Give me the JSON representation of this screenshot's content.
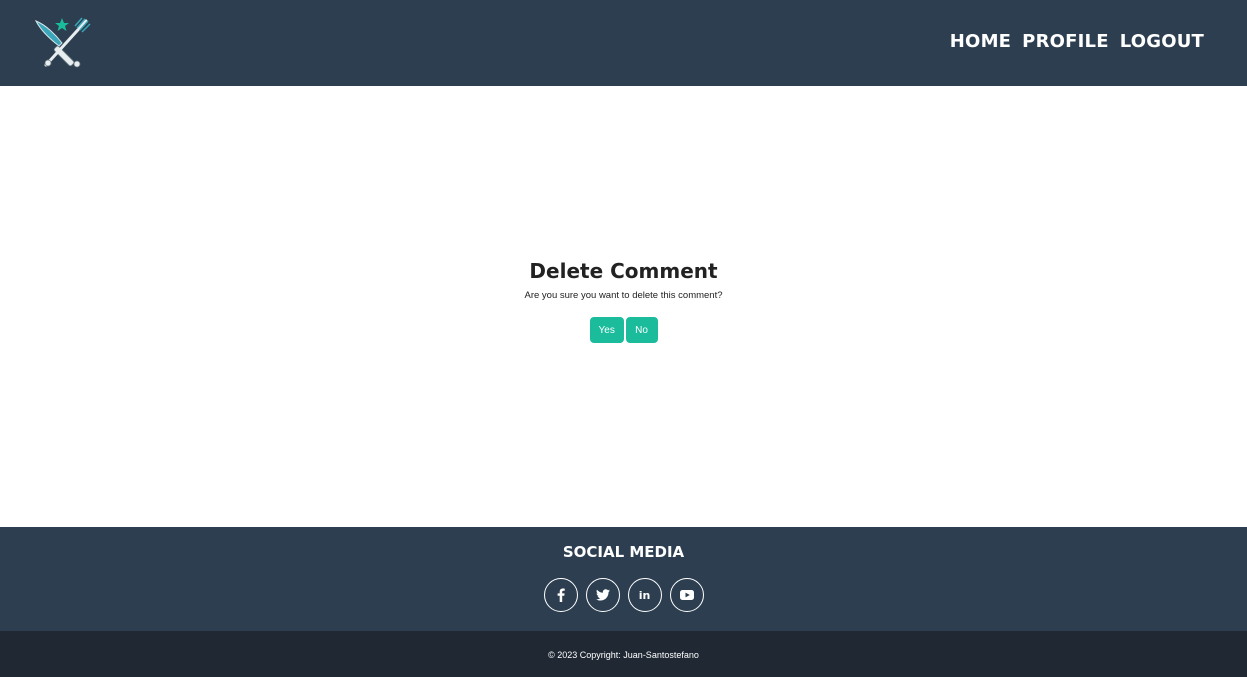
{
  "navbar": {
    "logo_icon": "crossed-knife-fork-logo-icon",
    "links": [
      {
        "label": "HOME"
      },
      {
        "label": "PROFILE"
      },
      {
        "label": "LOGOUT"
      }
    ]
  },
  "dialog": {
    "title": "Delete Comment",
    "message": "Are you sure you want to delete this comment?",
    "yes_label": "Yes",
    "no_label": "No"
  },
  "footer": {
    "title": "SOCIAL MEDIA",
    "social": [
      {
        "icon": "facebook-icon"
      },
      {
        "icon": "twitter-icon"
      },
      {
        "icon": "linkedin-icon",
        "text": "in"
      },
      {
        "icon": "youtube-icon"
      }
    ],
    "copyright": "© 2023 Copyright: Juan-Santostefano"
  },
  "colors": {
    "navbar_bg": "#2c3e50",
    "accent": "#1abc9c",
    "copyright_bg": "#1f2833"
  }
}
